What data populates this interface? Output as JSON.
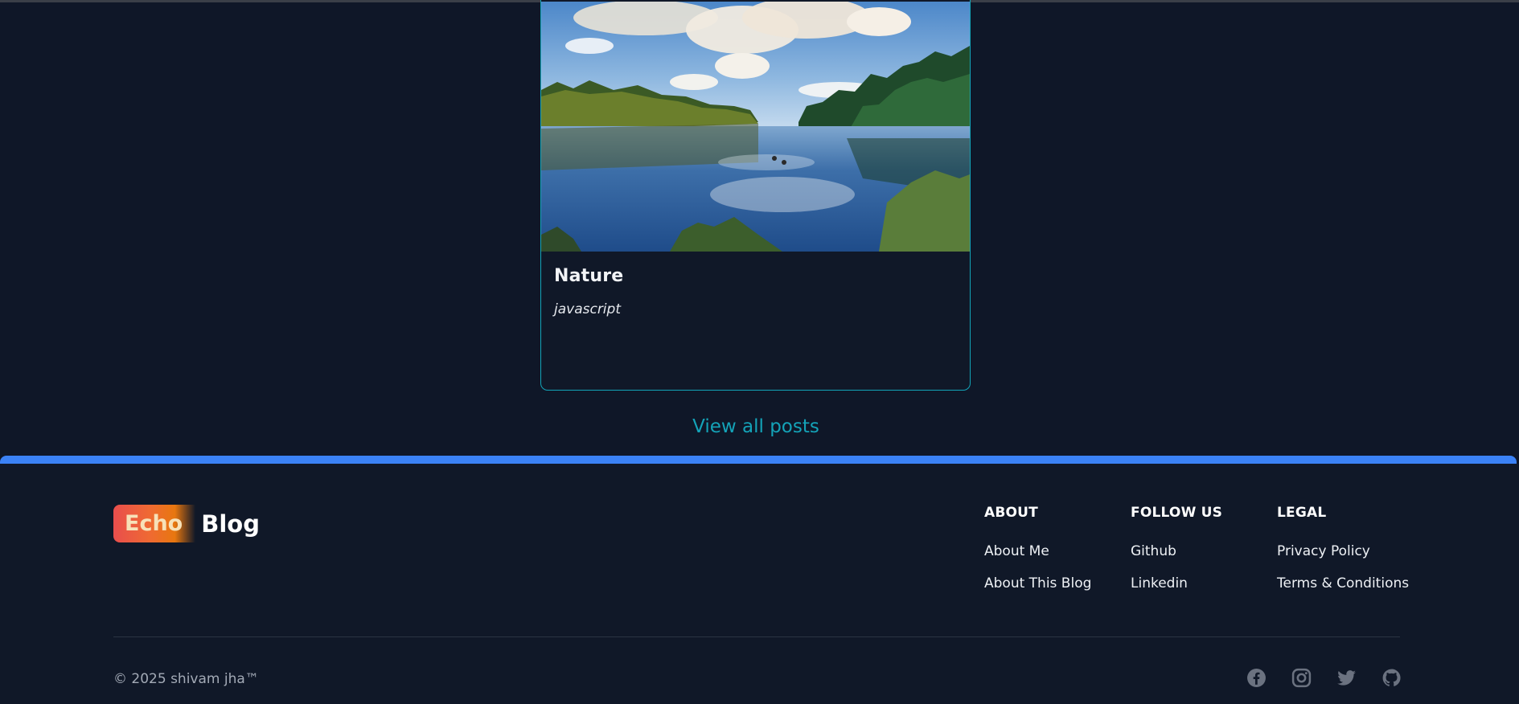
{
  "post": {
    "title": "Nature",
    "tag": "javascript"
  },
  "view_all_label": "View all posts",
  "footer": {
    "logo": {
      "badge_text": "Echo",
      "text": "Blog"
    },
    "columns": [
      {
        "heading": "ABOUT",
        "links": [
          "About Me",
          "About This Blog"
        ]
      },
      {
        "heading": "FOLLOW US",
        "links": [
          "Github",
          "Linkedin"
        ]
      },
      {
        "heading": "LEGAL",
        "links": [
          "Privacy Policy",
          "Terms & Conditions"
        ]
      }
    ],
    "copyright": "© 2025 shivam jha™",
    "social_icons": [
      "facebook-icon",
      "instagram-icon",
      "twitter-icon",
      "github-icon"
    ]
  },
  "colors": {
    "page_bg": "#0f1728",
    "accent_cyan": "#14a3b8",
    "footer_bar_blue": "#3b82f6",
    "social_icon_gray": "#6b7280"
  }
}
